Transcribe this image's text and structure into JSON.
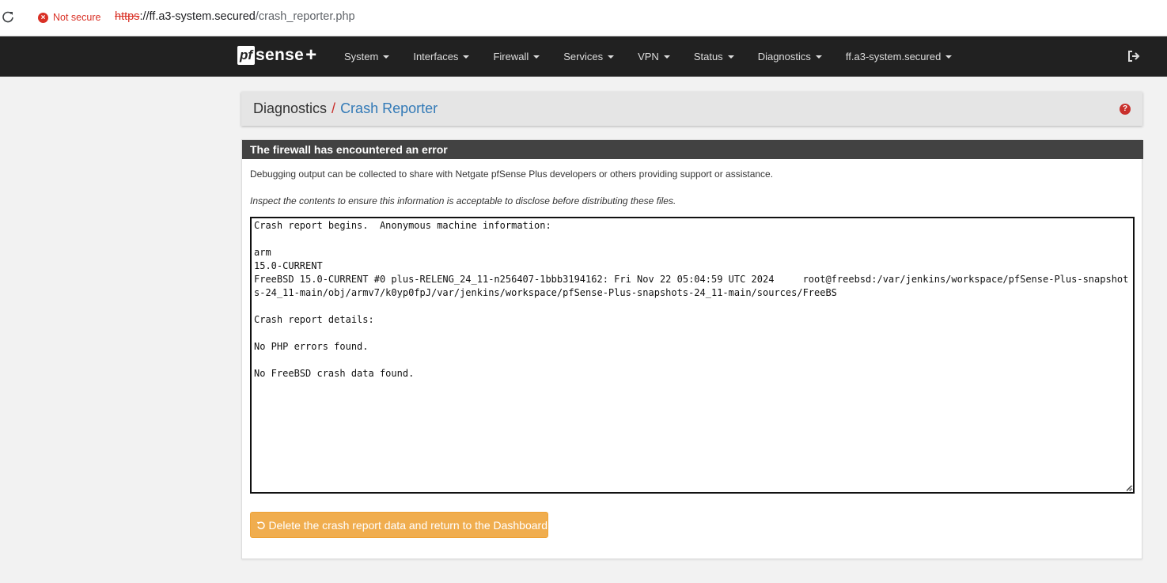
{
  "browser": {
    "security_label": "Not secure",
    "url_scheme": "https",
    "url_host": "://ff.a3-system.secured",
    "url_path": "/crash_reporter.php"
  },
  "navbar": {
    "brand_pf": "pf",
    "brand_sense": "sense",
    "brand_plus": "+",
    "items": [
      {
        "label": "System"
      },
      {
        "label": "Interfaces"
      },
      {
        "label": "Firewall"
      },
      {
        "label": "Services"
      },
      {
        "label": "VPN"
      },
      {
        "label": "Status"
      },
      {
        "label": "Diagnostics"
      },
      {
        "label": "ff.a3-system.secured"
      }
    ]
  },
  "breadcrumb": {
    "root": "Diagnostics",
    "separator": "/",
    "current": "Crash Reporter",
    "help_icon": "?"
  },
  "panel": {
    "title": "The firewall has encountered an error",
    "description": "Debugging output can be collected to share with Netgate pfSense Plus developers or others providing support or assistance.",
    "warning": "Inspect the contents to ensure this information is acceptable to disclose before distributing these files.",
    "report_text": "Crash report begins.  Anonymous machine information:\n\narm\n15.0-CURRENT\nFreeBSD 15.0-CURRENT #0 plus-RELENG_24_11-n256407-1bbb3194162: Fri Nov 22 05:04:59 UTC 2024     root@freebsd:/var/jenkins/workspace/pfSense-Plus-snapshots-24_11-main/obj/armv7/k0yp0fpJ/var/jenkins/workspace/pfSense-Plus-snapshots-24_11-main/sources/FreeBS\n\nCrash report details:\n\nNo PHP errors found.\n\nNo FreeBSD crash data found.",
    "delete_button_label": "Delete the crash report data and return to the Dashboard"
  },
  "colors": {
    "navbar_bg": "#212121",
    "panel_heading_bg": "#424242",
    "link_blue": "#337ab7",
    "warning_orange": "#f0ad4e",
    "danger_red": "#c9302c",
    "insecure_red": "#d93025"
  }
}
